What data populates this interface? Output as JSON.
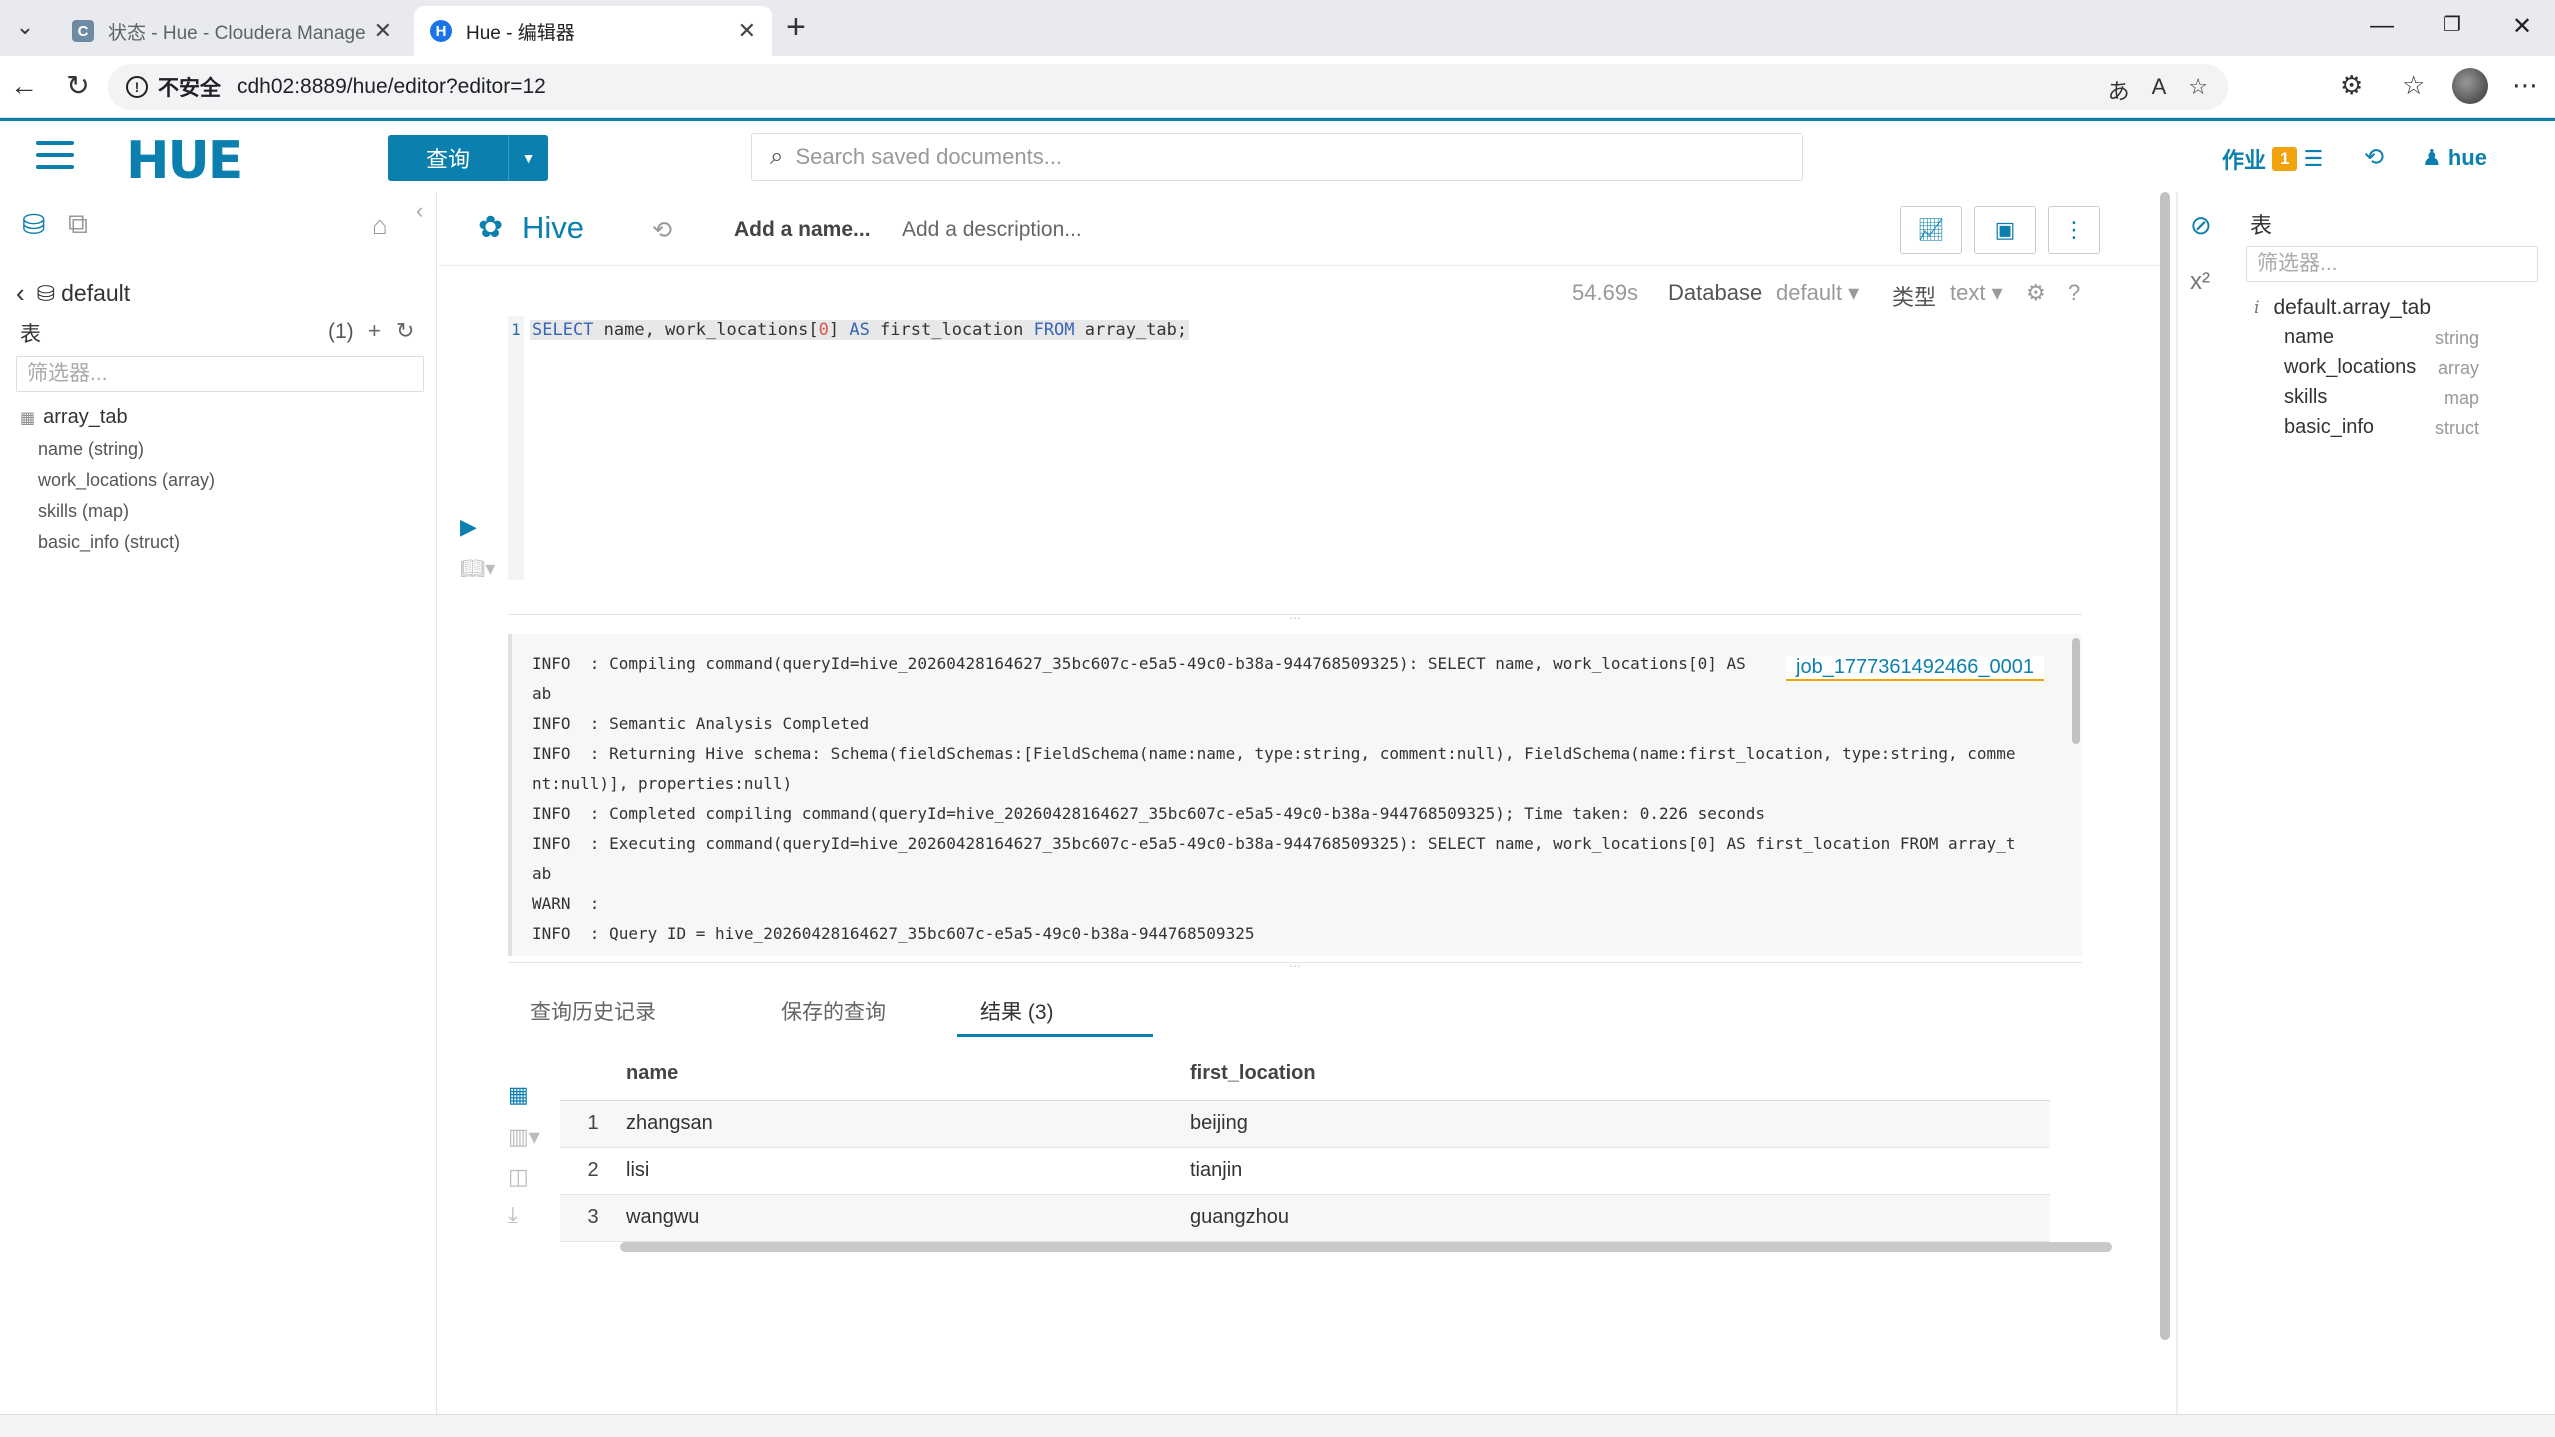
{
  "browser": {
    "tabs": [
      {
        "title": "状态 - Hue - Cloudera Manager",
        "favicon": "C",
        "active": false
      },
      {
        "title": "Hue - 编辑器",
        "favicon": "H",
        "active": true
      }
    ],
    "insecure_label": "不安全",
    "url": "cdh02:8889/hue/editor?editor=12"
  },
  "hue_nav": {
    "logo": "HUE",
    "query_button": "查询",
    "search_placeholder": "Search saved documents...",
    "jobs_label": "作业",
    "jobs_count": "1",
    "user": "hue"
  },
  "left_panel": {
    "database": "default",
    "tables_label": "表",
    "tables_count": "(1)",
    "filter_placeholder": "筛选器...",
    "table_name": "array_tab",
    "columns": [
      "name (string)",
      "work_locations (array)",
      "skills (map)",
      "basic_info (struct)"
    ]
  },
  "editor": {
    "engine": "Hive",
    "name_placeholder": "Add a name...",
    "desc_placeholder": "Add a description...",
    "elapsed": "54.69s",
    "database_label": "Database",
    "database_value": "default",
    "type_label": "类型",
    "type_value": "text",
    "help": "?",
    "line_number": "1",
    "query_parts": {
      "k1": "SELECT",
      "t1": " name, work_locations[",
      "n1": "0",
      "t2": "] ",
      "k2": "AS",
      "t3": " first_location ",
      "k3": "FROM",
      "t4": " array_tab;"
    }
  },
  "log": {
    "job_link": "job_1777361492466_0001",
    "lines": [
      "INFO  : Compiling command(queryId=hive_20260428164627_35bc607c-e5a5-49c0-b38a-944768509325): SELECT name, work_locations[0] AS",
      "ab",
      "INFO  : Semantic Analysis Completed",
      "INFO  : Returning Hive schema: Schema(fieldSchemas:[FieldSchema(name:name, type:string, comment:null), FieldSchema(name:first_location, type:string, comme",
      "nt:null)], properties:null)",
      "INFO  : Completed compiling command(queryId=hive_20260428164627_35bc607c-e5a5-49c0-b38a-944768509325); Time taken: 0.226 seconds",
      "INFO  : Executing command(queryId=hive_20260428164627_35bc607c-e5a5-49c0-b38a-944768509325): SELECT name, work_locations[0] AS first_location FROM array_t",
      "ab",
      "WARN  :",
      "INFO  : Query ID = hive_20260428164627_35bc607c-e5a5-49c0-b38a-944768509325"
    ]
  },
  "result_tabs": [
    "查询历史记录",
    "保存的查询",
    "结果 (3)"
  ],
  "results": {
    "headers": [
      "name",
      "first_location"
    ],
    "rows": [
      {
        "n": "1",
        "name": "zhangsan",
        "loc": "beijing"
      },
      {
        "n": "2",
        "name": "lisi",
        "loc": "tianjin"
      },
      {
        "n": "3",
        "name": "wangwu",
        "loc": "guangzhou"
      }
    ]
  },
  "right_panel": {
    "title": "表",
    "filter_placeholder": "筛选器...",
    "table": "default.array_tab",
    "columns": [
      {
        "name": "name",
        "type": "string"
      },
      {
        "name": "work_locations",
        "type": "array"
      },
      {
        "name": "skills",
        "type": "map"
      },
      {
        "name": "basic_info",
        "type": "struct"
      }
    ]
  },
  "colors": {
    "hue_blue": "#0b7fad",
    "badge_orange": "#f0a30a"
  }
}
